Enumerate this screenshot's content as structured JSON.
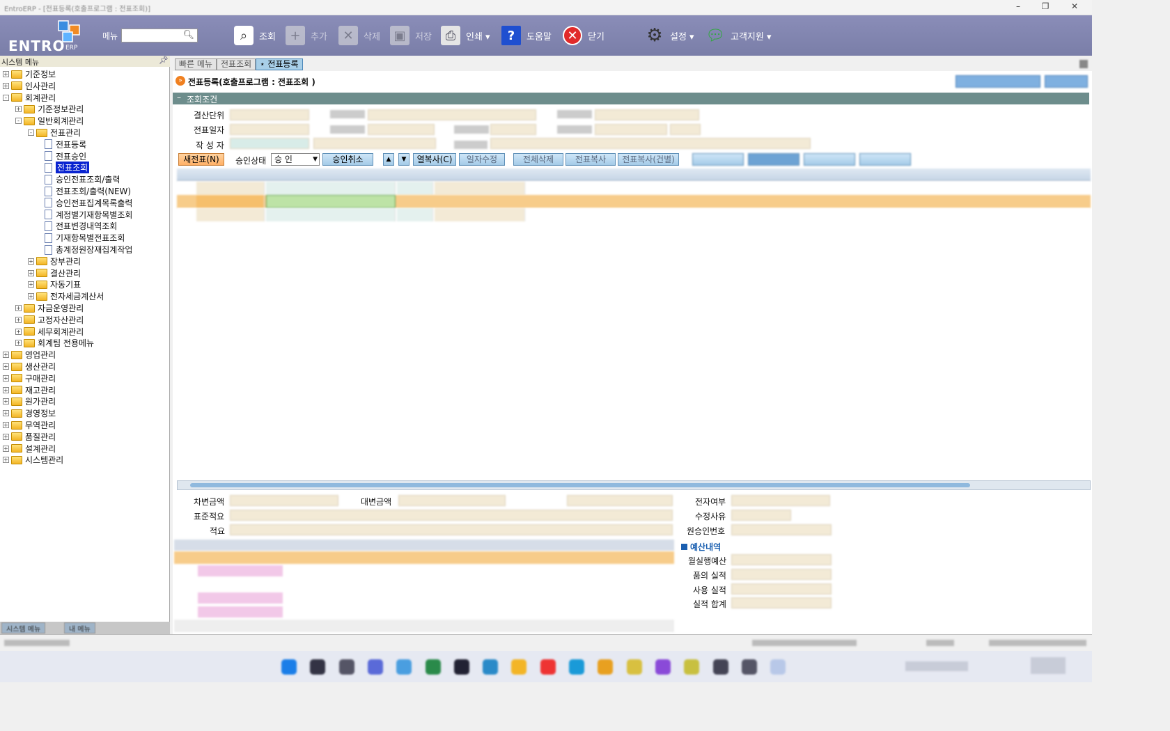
{
  "window": {
    "title": "EntroERP - [전표등록(호출프로그램 : 전표조회)]",
    "min": "–",
    "max": "❐",
    "close": "✕"
  },
  "toolbar": {
    "logo": "ENTRO",
    "logo_sub": "ERP",
    "menu_label": "메뉴",
    "menu_search_placeholder": "",
    "buttons": [
      {
        "label": "조회",
        "icon": "search-icon"
      },
      {
        "label": "추가",
        "icon": "add-icon"
      },
      {
        "label": "삭제",
        "icon": "delete-icon"
      },
      {
        "label": "저장",
        "icon": "save-icon"
      },
      {
        "label": "인쇄 ▾",
        "icon": "print-icon"
      },
      {
        "label": "도움말",
        "icon": "help-icon"
      },
      {
        "label": "닫기",
        "icon": "close-icon"
      },
      {
        "label": "설정 ▾",
        "icon": "gear-icon"
      },
      {
        "label": "고객지원 ▾",
        "icon": "chat-icon"
      }
    ]
  },
  "sidebar": {
    "header": "시스템 메뉴",
    "items": [
      {
        "label": "기준정보",
        "level": 0,
        "type": "folder",
        "pm": "+"
      },
      {
        "label": "인사관리",
        "level": 0,
        "type": "folder",
        "pm": "+"
      },
      {
        "label": "회계관리",
        "level": 0,
        "type": "folder",
        "pm": "-"
      },
      {
        "label": "기준정보관리",
        "level": 1,
        "type": "folder",
        "pm": "+"
      },
      {
        "label": "일반회계관리",
        "level": 1,
        "type": "folder",
        "pm": "-"
      },
      {
        "label": "전표관리",
        "level": 2,
        "type": "folder",
        "pm": "-"
      },
      {
        "label": "전표등록",
        "level": 3,
        "type": "doc"
      },
      {
        "label": "전표승인",
        "level": 3,
        "type": "doc"
      },
      {
        "label": "전표조회",
        "level": 3,
        "type": "doc",
        "selected": true
      },
      {
        "label": "승인전표조회/출력",
        "level": 3,
        "type": "doc"
      },
      {
        "label": "전표조회/출력(NEW)",
        "level": 3,
        "type": "doc"
      },
      {
        "label": "승인전표집계목록출력",
        "level": 3,
        "type": "doc"
      },
      {
        "label": "계정별기재항목별조회",
        "level": 3,
        "type": "doc"
      },
      {
        "label": "전표변경내역조회",
        "level": 3,
        "type": "doc"
      },
      {
        "label": "기재항목별전표조회",
        "level": 3,
        "type": "doc"
      },
      {
        "label": "총계정원장재집계작업",
        "level": 3,
        "type": "doc"
      },
      {
        "label": "장부관리",
        "level": 2,
        "type": "folder",
        "pm": "+"
      },
      {
        "label": "결산관리",
        "level": 2,
        "type": "folder",
        "pm": "+"
      },
      {
        "label": "자동기표",
        "level": 2,
        "type": "folder",
        "pm": "+"
      },
      {
        "label": "전자세금계산서",
        "level": 2,
        "type": "folder",
        "pm": "+"
      },
      {
        "label": "자금운영관리",
        "level": 1,
        "type": "folder",
        "pm": "+"
      },
      {
        "label": "고정자산관리",
        "level": 1,
        "type": "folder",
        "pm": "+"
      },
      {
        "label": "세무회계관리",
        "level": 1,
        "type": "folder",
        "pm": "+"
      },
      {
        "label": "회계팀 전용메뉴",
        "level": 1,
        "type": "folder",
        "pm": "+"
      },
      {
        "label": "영업관리",
        "level": 0,
        "type": "folder",
        "pm": "+"
      },
      {
        "label": "생산관리",
        "level": 0,
        "type": "folder",
        "pm": "+"
      },
      {
        "label": "구매관리",
        "level": 0,
        "type": "folder",
        "pm": "+"
      },
      {
        "label": "재고관리",
        "level": 0,
        "type": "folder",
        "pm": "+"
      },
      {
        "label": "원가관리",
        "level": 0,
        "type": "folder",
        "pm": "+"
      },
      {
        "label": "경영정보",
        "level": 0,
        "type": "folder",
        "pm": "+"
      },
      {
        "label": "무역관리",
        "level": 0,
        "type": "folder",
        "pm": "+"
      },
      {
        "label": "품질관리",
        "level": 0,
        "type": "folder",
        "pm": "+"
      },
      {
        "label": "설계관리",
        "level": 0,
        "type": "folder",
        "pm": "+"
      },
      {
        "label": "시스템관리",
        "level": 0,
        "type": "folder",
        "pm": "+"
      }
    ],
    "bottom_tabs": [
      "시스템 메뉴",
      "내 메뉴"
    ]
  },
  "tabs": [
    {
      "label": "빠른 메뉴"
    },
    {
      "label": "전표조회"
    },
    {
      "label": "⋆ 전표등록",
      "active": true
    }
  ],
  "page": {
    "title": "전표등록(호출프로그램 : 전표조회 )",
    "section_header": "조회조건",
    "labels": {
      "unit": "결산단위",
      "date": "전표일자",
      "writer": "작 성 자"
    },
    "buttons": {
      "new": "새전표(N)",
      "approve_state_label": "승인상태",
      "approve_state_value": "승 인",
      "cancel_approve": "승인취소",
      "row_copy": "열복사(C)",
      "date_edit": "일자수정",
      "delete_all": "전체삭제",
      "copy": "전표복사",
      "copy_each": "전표복사(건별)"
    },
    "totals": {
      "debit_label": "차변금액",
      "credit_label": "대변금액",
      "standard_label": "표준적요",
      "summary_label": "적요"
    },
    "right_panel": {
      "e_label": "전자여부",
      "reason_label": "수정사유",
      "orig_label": "원승인번호",
      "budget_header": "예산내역",
      "budget_rows": [
        "월실행예산",
        "품의 실적",
        "사용 실적",
        "실적 합계"
      ]
    }
  },
  "taskbar": {
    "icons": [
      "start-icon",
      "search-icon",
      "explorer-icon",
      "chat-icon",
      "photos-icon",
      "settings-icon",
      "camera-icon",
      "globe-icon",
      "folder-icon",
      "store-icon",
      "edge-icon",
      "chrome-icon",
      "paint-icon",
      "vs-icon",
      "tool-icon",
      "calc-icon",
      "notepad-icon",
      "erp-icon"
    ]
  }
}
